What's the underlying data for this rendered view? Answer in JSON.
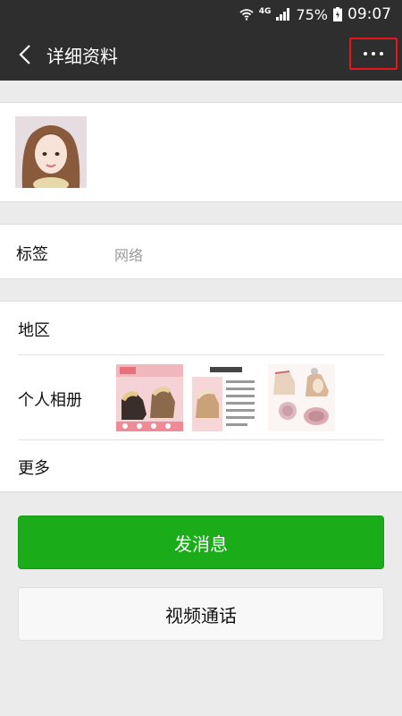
{
  "status_bar": {
    "network": "4G",
    "battery": "75%",
    "time": "09:07"
  },
  "nav": {
    "title": "详细资料"
  },
  "tags_row": {
    "label": "标签",
    "value": "网络"
  },
  "info": {
    "region_label": "地区",
    "album_label": "个人相册",
    "more_label": "更多"
  },
  "buttons": {
    "send_message": "发消息",
    "video_call": "视频通话"
  },
  "icons": {
    "back": "chevron-left-icon",
    "more": "more-dots-icon",
    "wifi": "wifi-icon",
    "signal": "signal-icon",
    "battery": "battery-icon"
  },
  "colors": {
    "navbar": "#2e2e2e",
    "primary_button": "#1aad19",
    "highlight_box": "#e8161b"
  }
}
